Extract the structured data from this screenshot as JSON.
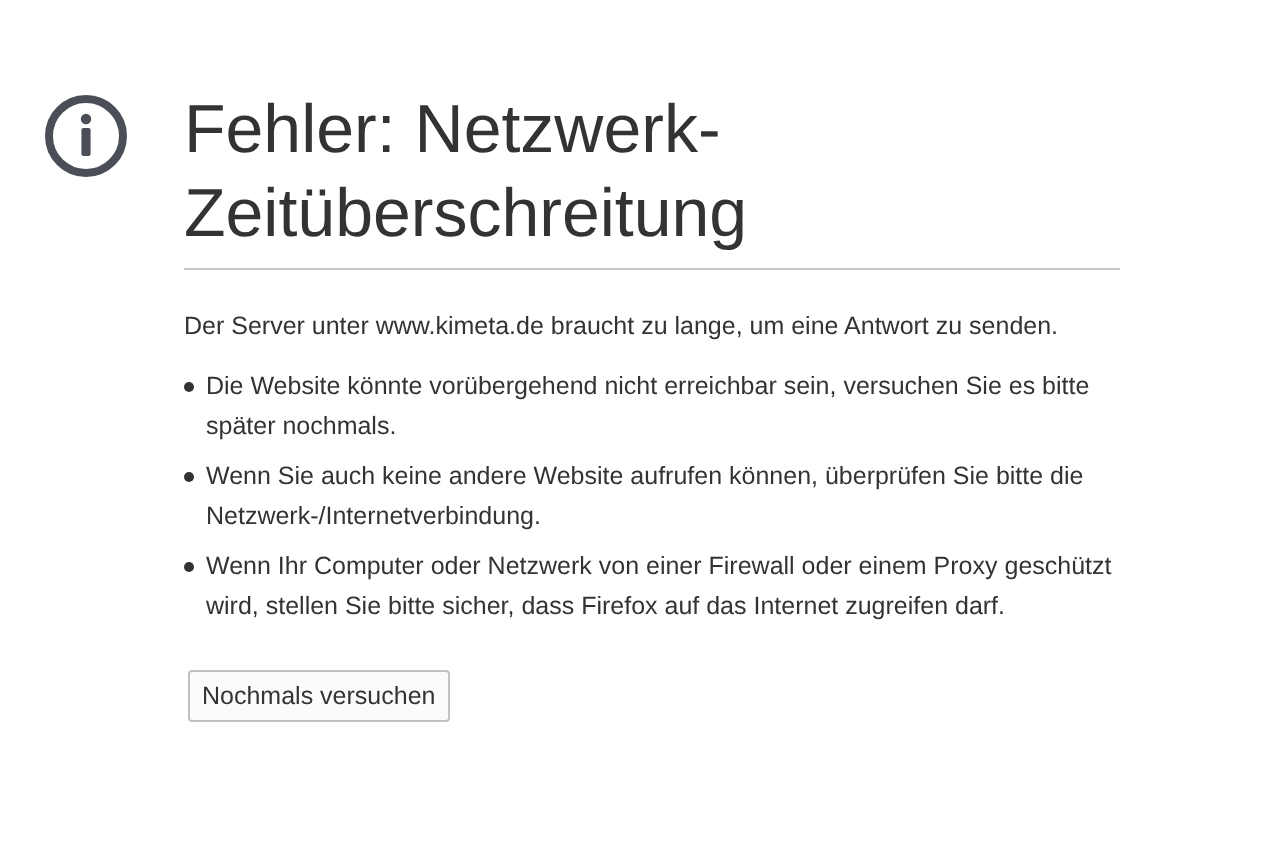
{
  "title": "Fehler: Netzwerk-Zeitüberschreitung",
  "description": "Der Server unter www.kimeta.de braucht zu lange, um eine Antwort zu senden.",
  "suggestions": [
    "Die Website könnte vorübergehend nicht erreichbar sein, versuchen Sie es bitte später nochmals.",
    "Wenn Sie auch keine andere Website aufrufen können, überprüfen Sie bitte die Netzwerk-/Internetverbindung.",
    "Wenn Ihr Computer oder Netzwerk von einer Firewall oder einem Proxy geschützt wird, stellen Sie bitte sicher, dass Firefox auf das Internet zugreifen darf."
  ],
  "button": "Nochmals versuchen"
}
